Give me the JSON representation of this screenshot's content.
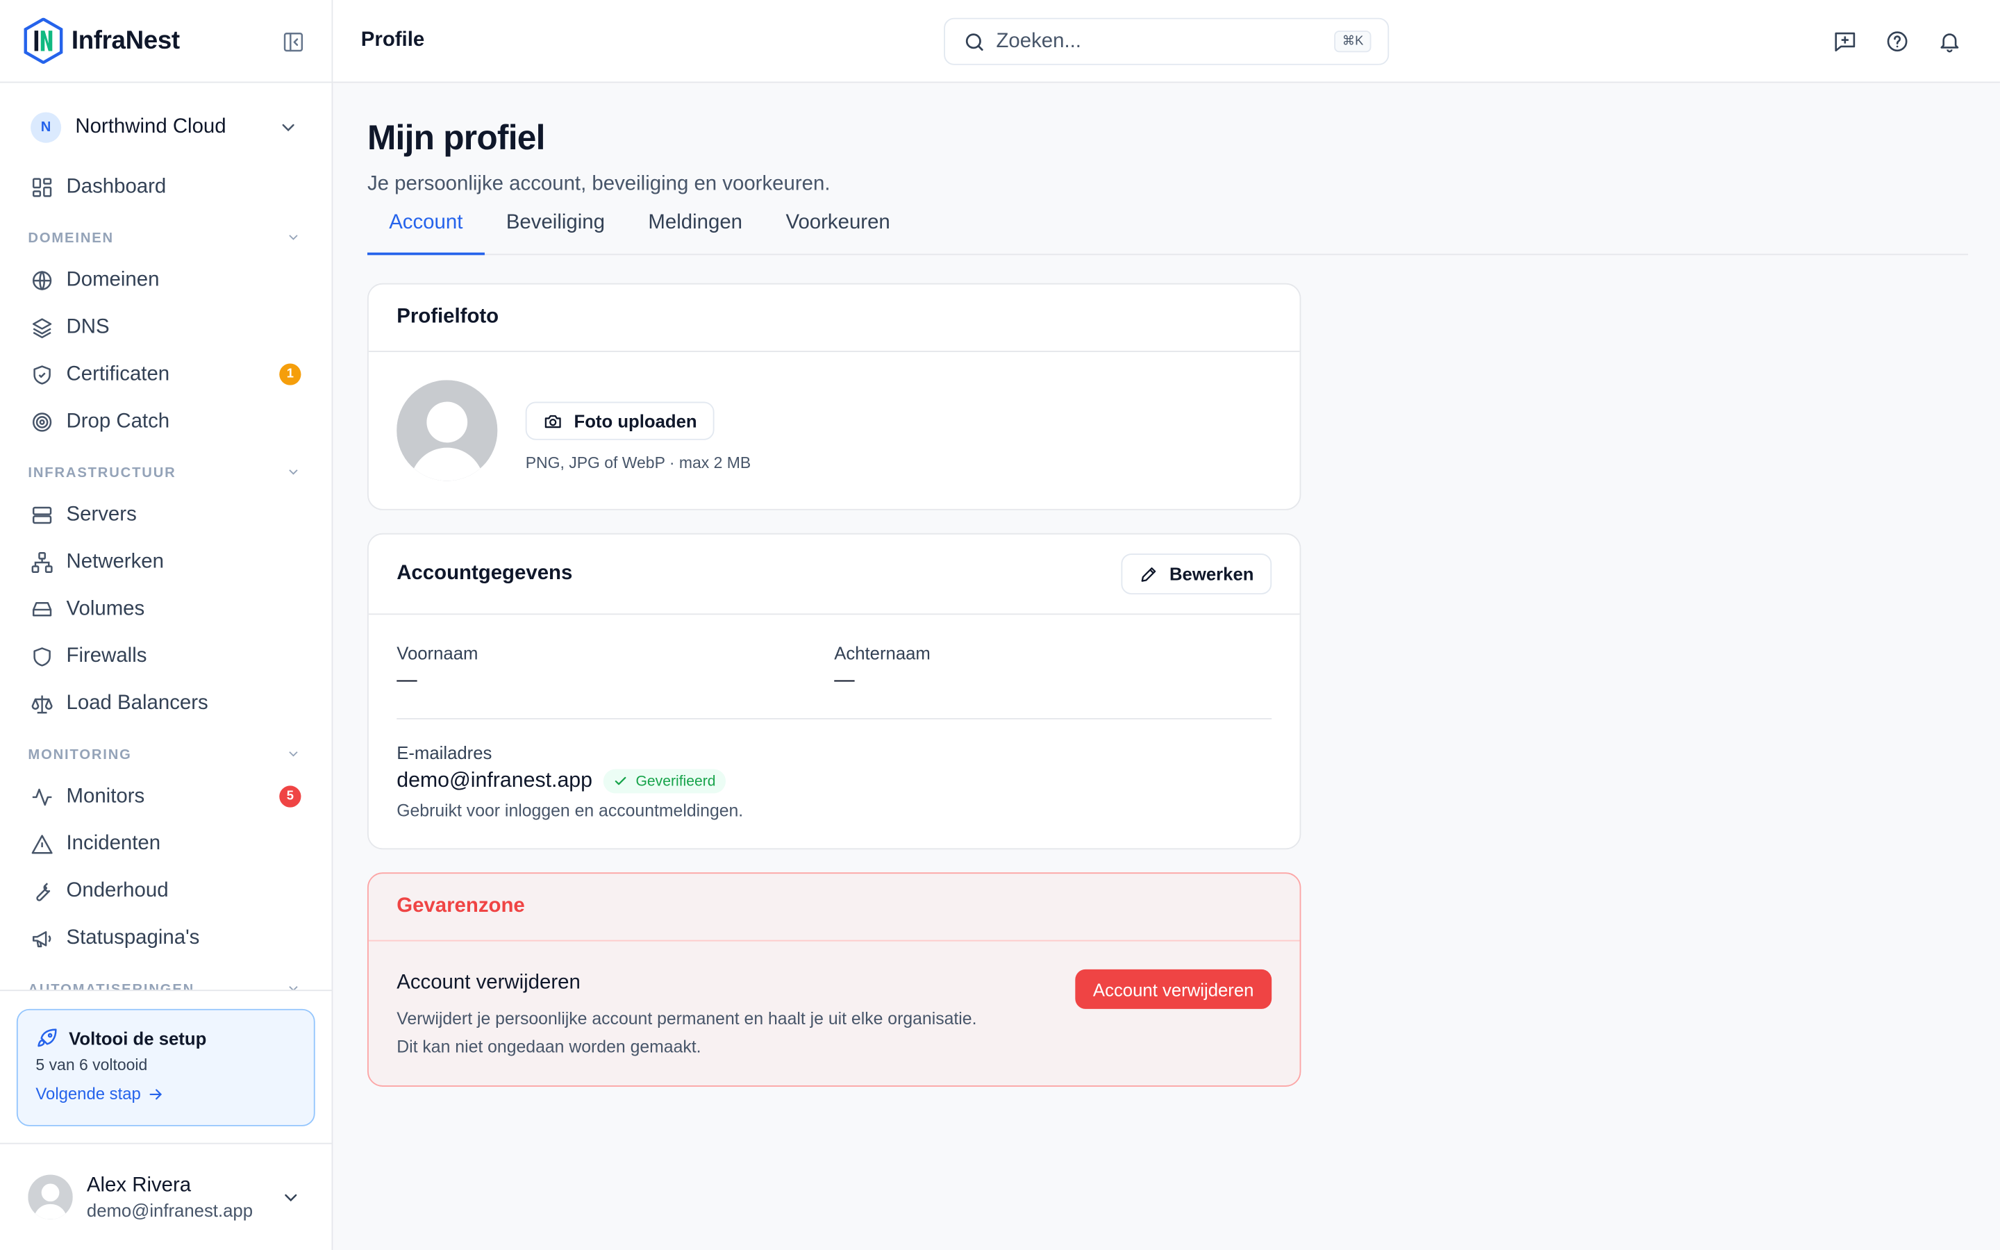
{
  "app": {
    "name": "InfraNest"
  },
  "workspace": {
    "initial": "N",
    "name": "Northwind Cloud"
  },
  "nav": {
    "dashboard": "Dashboard",
    "sections": {
      "domeinen": "DOMEINEN",
      "infrastructuur": "INFRASTRUCTUUR",
      "monitoring": "MONITORING",
      "automatiseringen": "AUTOMATISERINGEN"
    },
    "items": {
      "domeinen": "Domeinen",
      "dns": "DNS",
      "certificaten": "Certificaten",
      "dropcatch": "Drop Catch",
      "servers": "Servers",
      "netwerken": "Netwerken",
      "volumes": "Volumes",
      "firewalls": "Firewalls",
      "loadbalancers": "Load Balancers",
      "monitors": "Monitors",
      "incidenten": "Incidenten",
      "onderhoud": "Onderhoud",
      "statuspaginas": "Statuspagina's"
    },
    "badges": {
      "certificaten": "1",
      "monitors": "5"
    }
  },
  "setup": {
    "title": "Voltooi de setup",
    "progress": "5 van 6 voltooid",
    "link": "Volgende stap"
  },
  "user": {
    "name": "Alex Rivera",
    "email": "demo@infranest.app"
  },
  "topbar": {
    "title": "Profile",
    "search_placeholder": "Zoeken...",
    "shortcut": "⌘K"
  },
  "page": {
    "title": "Mijn profiel",
    "subtitle": "Je persoonlijke account, beveiliging en voorkeuren.",
    "tabs": [
      "Account",
      "Beveiliging",
      "Meldingen",
      "Voorkeuren"
    ]
  },
  "photo": {
    "title": "Profielfoto",
    "upload": "Foto uploaden",
    "hint": "PNG, JPG of WebP · max 2 MB"
  },
  "account": {
    "title": "Accountgegevens",
    "edit": "Bewerken",
    "first_name_label": "Voornaam",
    "first_name_value": "—",
    "last_name_label": "Achternaam",
    "last_name_value": "—",
    "email_label": "E-mailadres",
    "email_value": "demo@infranest.app",
    "verified": "Geverifieerd",
    "email_note": "Gebruikt voor inloggen en accountmeldingen."
  },
  "danger": {
    "title": "Gevarenzone",
    "action_title": "Account verwijderen",
    "desc1": "Verwijdert je persoonlijke account permanent en haalt je uit elke organisatie.",
    "desc2": "Dit kan niet ongedaan worden gemaakt.",
    "button": "Account verwijderen"
  },
  "colors": {
    "accent": "#2563eb",
    "danger": "#ef4444",
    "warning": "#f59e0b",
    "success": "#16a34a"
  }
}
